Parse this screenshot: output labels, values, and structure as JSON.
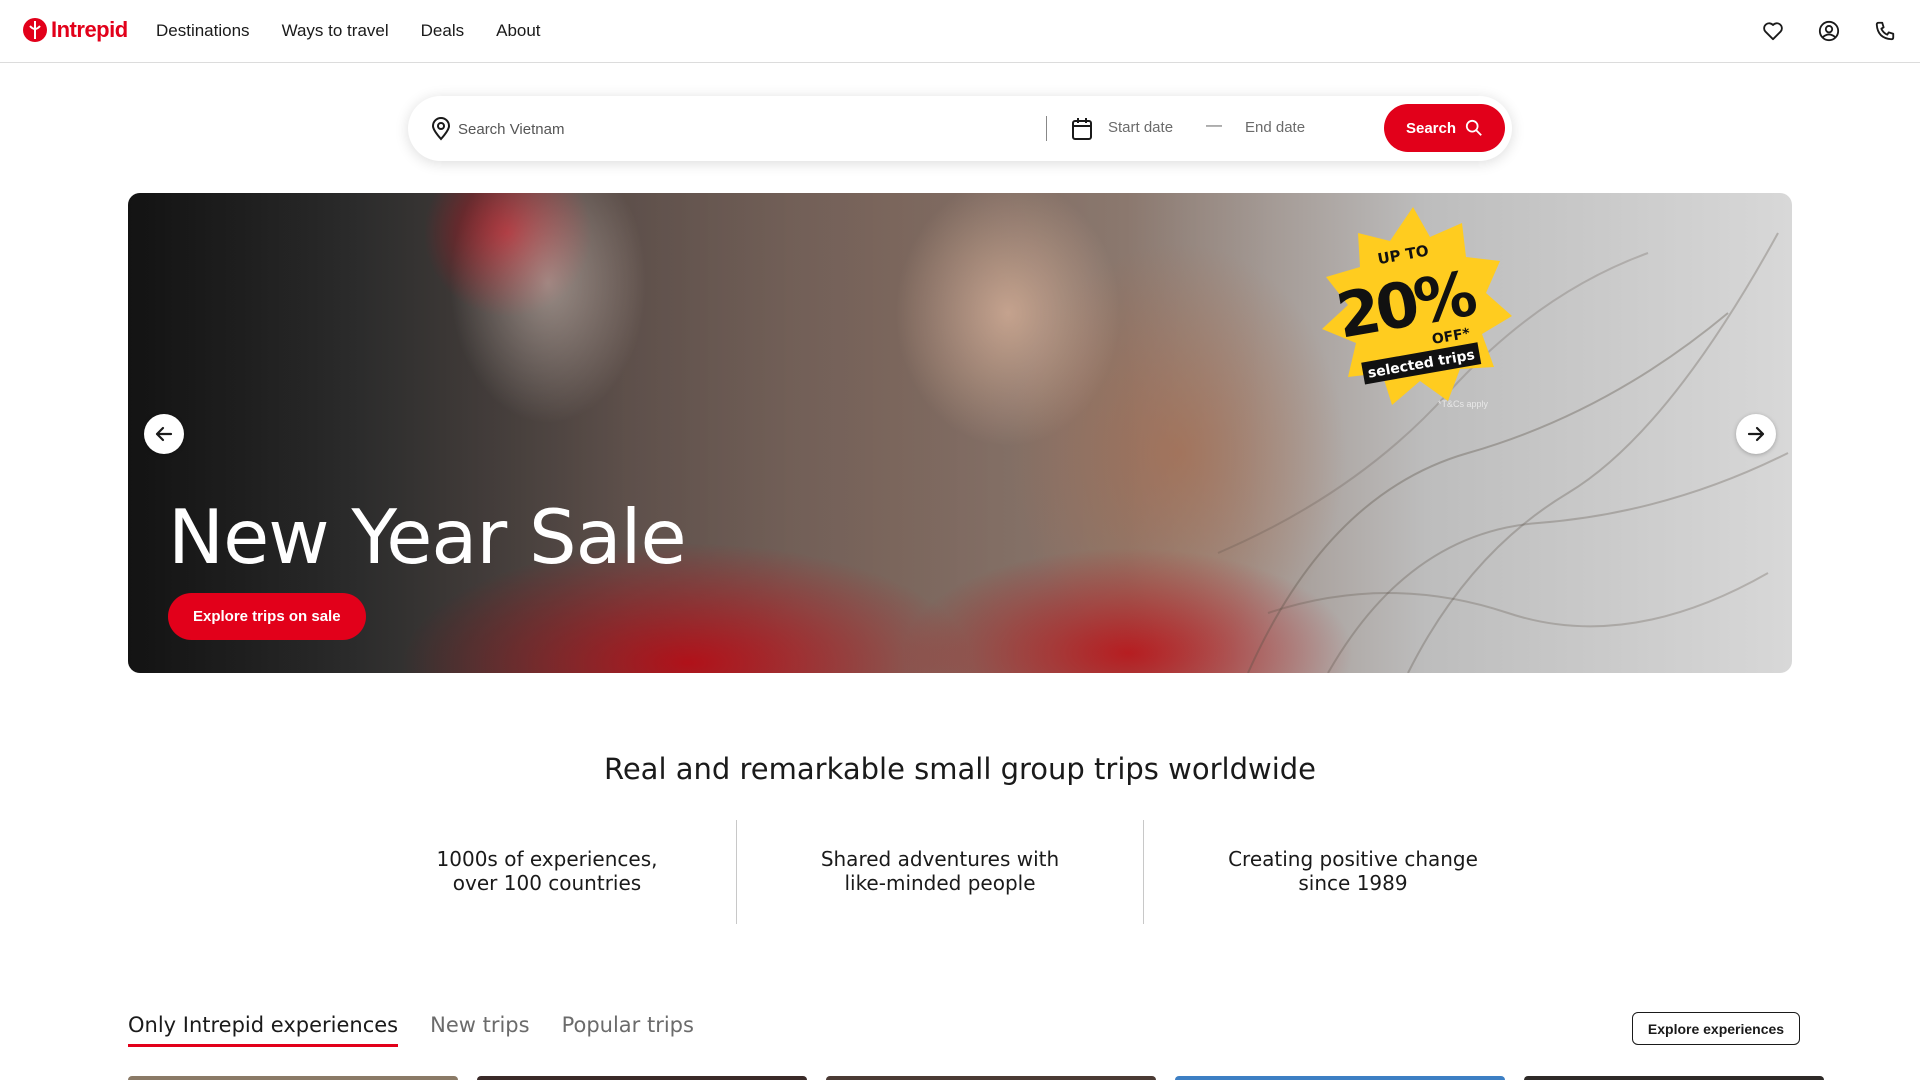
{
  "brand": {
    "name": "Intrepid",
    "color": "#e2001a"
  },
  "nav": {
    "items": [
      {
        "label": "Destinations"
      },
      {
        "label": "Ways to travel"
      },
      {
        "label": "Deals"
      },
      {
        "label": "About"
      }
    ],
    "icons": [
      "heart-icon",
      "account-icon",
      "phone-icon"
    ]
  },
  "search": {
    "placeholder": "Search Vietnam",
    "start_date": "Start date",
    "dash": "—",
    "end_date": "End date",
    "button_label": "Search"
  },
  "hero": {
    "title": "New Year Sale",
    "button_label": "Explore trips on sale",
    "badge": {
      "line1": "UP TO",
      "percent": "20%",
      "off": "OFF*",
      "line3": "selected trips",
      "color": "#ffcc1f"
    },
    "terms": "*T&Cs apply"
  },
  "tagline": "Real and remarkable small group trips worldwide",
  "features": [
    {
      "line1": "1000s of experiences,",
      "line2": "over 100 countries"
    },
    {
      "line1": "Shared adventures with",
      "line2": "like-minded people"
    },
    {
      "line1": "Creating positive change",
      "line2": "since 1989"
    }
  ],
  "tabs": [
    {
      "label": "Only Intrepid experiences",
      "active": true
    },
    {
      "label": "New trips",
      "active": false
    },
    {
      "label": "Popular trips",
      "active": false
    }
  ],
  "explore_experiences_label": "Explore experiences"
}
